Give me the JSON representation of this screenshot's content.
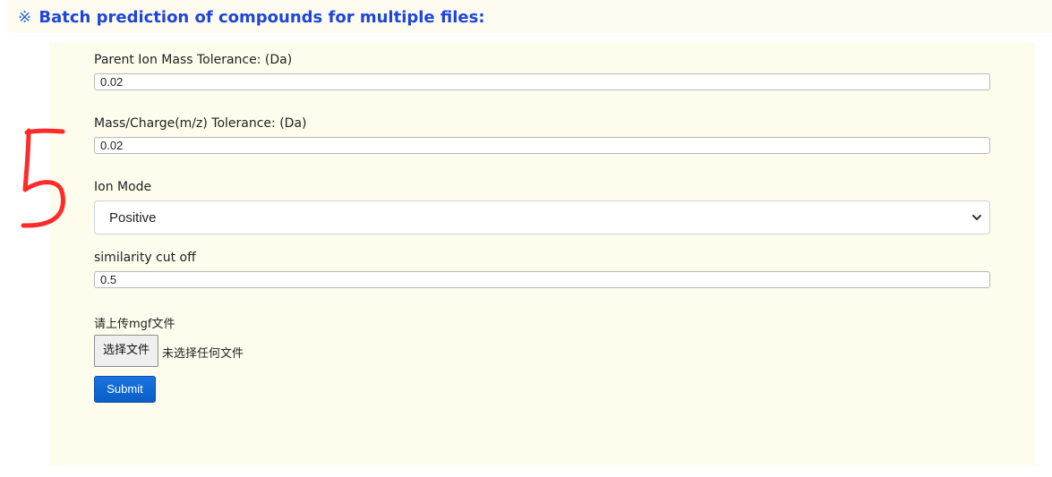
{
  "header": {
    "mark": "※",
    "title": "Batch prediction of compounds for multiple files:"
  },
  "form": {
    "parent_tolerance": {
      "label": "Parent Ion Mass Tolerance: (Da)",
      "value": "0.02"
    },
    "mz_tolerance": {
      "label": "Mass/Charge(m/z) Tolerance: (Da)",
      "value": "0.02"
    },
    "ion_mode": {
      "label": "Ion Mode",
      "selected": "Positive"
    },
    "similarity": {
      "label": "similarity cut off",
      "value": "0.5"
    },
    "upload": {
      "label": "请上传mgf文件",
      "button_label": "选择文件",
      "status": "未选择任何文件"
    },
    "submit_label": "Submit"
  },
  "annotation": {
    "text": "5",
    "color": "#ff2a2a"
  },
  "colors": {
    "title": "#1e46d8",
    "panel_bg": "#fefcec",
    "submit_bg": "#0a66d6"
  }
}
